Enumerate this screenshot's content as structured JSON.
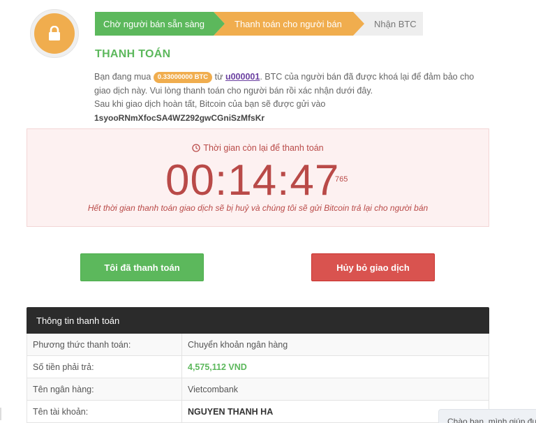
{
  "steps": [
    {
      "label": "Chờ người bán sẵn sàng"
    },
    {
      "label": "Thanh toán cho người bán"
    },
    {
      "label": "Nhận BTC"
    }
  ],
  "title": "THANH TOÁN",
  "description": {
    "part1": "Bạn đang mua",
    "amount_badge": "0.33000000 BTC",
    "part2": "từ",
    "seller": "u000001",
    "part3": ". BTC của người bán đã được khoá lại để đảm bảo cho giao dịch này. Vui lòng thanh toán cho người bán rồi xác nhận dưới đây.",
    "line2": "Sau khi giao dịch hoàn tất, Bitcoin của bạn sẽ được gửi vào",
    "address": "1syooRNmXfocSA4WZ292gwCGniSzMfsKr"
  },
  "timer": {
    "label": "Thời gian còn lại để thanh toán",
    "value": "00:14:47",
    "ms": "765",
    "note": "Hết thời gian thanh toán giao dịch sẽ bị huỷ và chúng tôi sẽ gửi Bitcoin trả lại cho người bán"
  },
  "buttons": {
    "paid": "Tôi đã thanh toán",
    "cancel": "Hủy bỏ giao dịch"
  },
  "info": {
    "header": "Thông tin thanh toán",
    "rows": [
      {
        "key": "Phương thức thanh toán:",
        "value": "Chuyển khoản ngân hàng"
      },
      {
        "key": "Số tiền phải trả:",
        "value": "4,575,112 VND"
      },
      {
        "key": "Tên ngân hàng:",
        "value": "Vietcombank"
      },
      {
        "key": "Tên tài khoản:",
        "value": "NGUYEN THANH HA"
      }
    ]
  },
  "chat": {
    "label": "Chào bạn, mình giúp được gì"
  },
  "colors": {
    "green": "#5cb85c",
    "orange": "#f0ad4e",
    "red": "#d9534f",
    "dark": "#2b2b2b"
  },
  "icons": {
    "avatar": "lock-icon",
    "timer": "clock-icon"
  }
}
